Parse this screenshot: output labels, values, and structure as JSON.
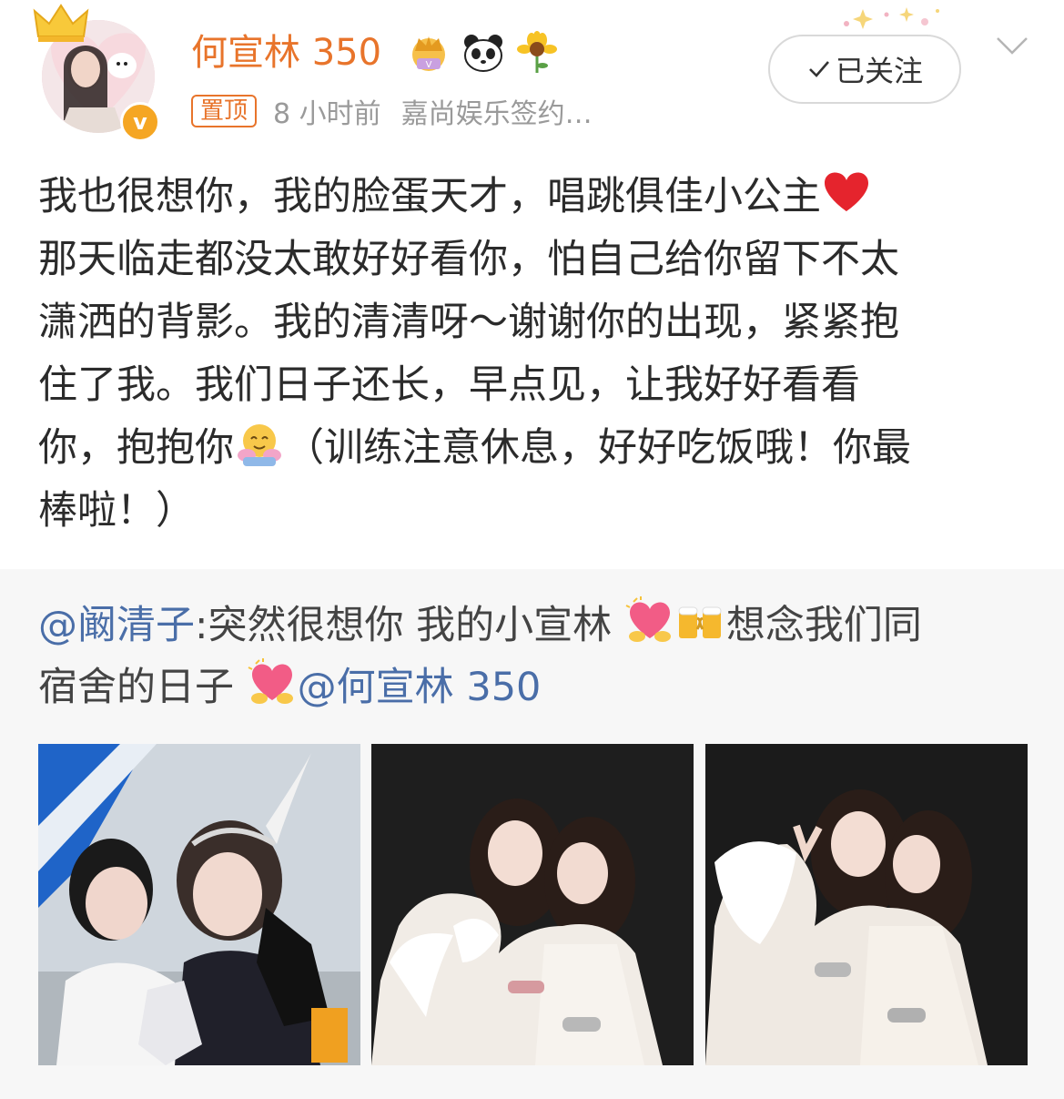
{
  "header": {
    "username": "何宣林 350",
    "pin_label": "置顶",
    "time": "8 小时前",
    "source": "嘉尚娱乐签约…",
    "follow_label": "已关注",
    "badge_icons": [
      "crown-badge-icon",
      "panda-icon",
      "sunflower-icon"
    ],
    "verified_mark": "v"
  },
  "post": {
    "lines": [
      "我也很想你，我的脸蛋天才，唱跳俱佳小公主",
      "那天临走都没太敢好好看你，怕自己给你留下不太",
      "潇洒的背影。我的清清呀～谢谢你的出现，紧紧抱",
      "住了我。我们日子还长，早点见，让我好好看看",
      "你，抱抱你",
      "（训练注意休息，好好吃饭哦！你最",
      "棒啦！）"
    ]
  },
  "repost": {
    "mention_author": "@阚清子",
    "text_1": ":突然很想你 我的小宣林 ",
    "text_2": "想念我们同",
    "text_3": "宿舍的日子 ",
    "mention_target": "@何宣林 350"
  },
  "photos": [
    {
      "name": "photo-1"
    },
    {
      "name": "photo-2"
    },
    {
      "name": "photo-3"
    }
  ],
  "colors": {
    "username": "#e8742b",
    "meta": "#9a9a9a",
    "mention": "#4a6ea8",
    "repost_bg": "#f7f7f7"
  }
}
